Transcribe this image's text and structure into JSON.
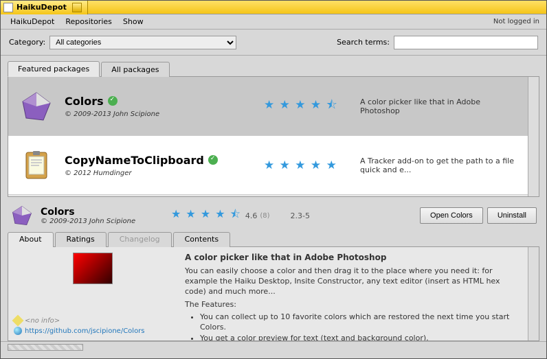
{
  "window": {
    "title": "HaikuDepot"
  },
  "menubar": {
    "items": [
      "HaikuDepot",
      "Repositories",
      "Show"
    ],
    "right": "Not logged in"
  },
  "toolbar": {
    "category_label": "Category:",
    "category_value": "All categories",
    "search_label": "Search terms:",
    "search_value": ""
  },
  "list_tabs": {
    "featured": "Featured packages",
    "all": "All packages"
  },
  "packages": [
    {
      "name": "Colors",
      "copyright": "© 2009-2013 John Scipione",
      "stars": "★ ★ ★ ★ ⯪",
      "summary": "A color picker like that in Adobe Photoshop",
      "selected": true
    },
    {
      "name": "CopyNameToClipboard",
      "copyright": "© 2012 Humdinger",
      "stars": "★ ★ ★ ★ ★",
      "summary": "A Tracker add-on to get the path to a file quick and e...",
      "selected": false
    }
  ],
  "detail": {
    "name": "Colors",
    "copyright": "© 2009-2013 John Scipione",
    "stars": "★ ★ ★ ★ ⯪",
    "rating": "4.6",
    "rating_count": "(8)",
    "version": "2.3-5",
    "open_btn": "Open Colors",
    "uninstall_btn": "Uninstall"
  },
  "detail_tabs": {
    "about": "About",
    "ratings": "Ratings",
    "changelog": "Changelog",
    "contents": "Contents"
  },
  "about": {
    "headline": "A color picker like that in Adobe Photoshop",
    "para": "You can easily choose a color and then drag it to the place where you  need it: for example the Haiku Desktop, Insite Constructor, any text  editor (insert as HTML hex code) and much more...",
    "features_head": "The Features:",
    "features": [
      "You can collect up to 10 favorite colors which are restored the next time  you start Colors.",
      "You get a color preview for text (text and background color)."
    ],
    "noinfo": "<no info>",
    "url": "https://github.com/jscipione/Colors"
  }
}
